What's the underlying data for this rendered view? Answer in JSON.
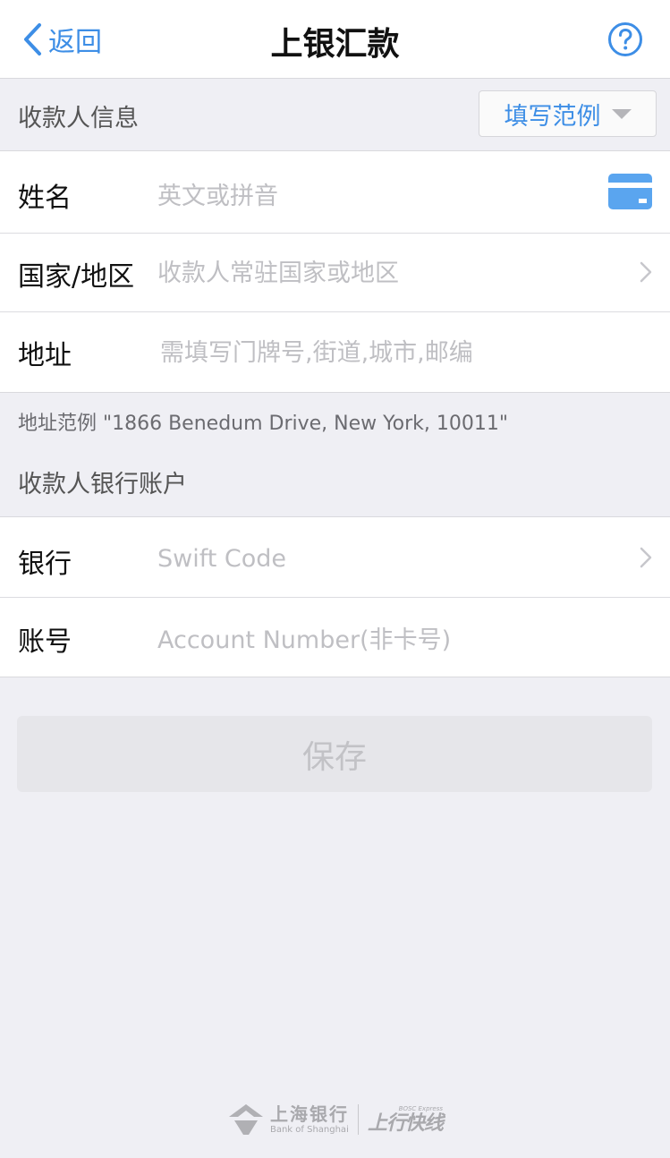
{
  "nav": {
    "back_label": "返回",
    "title": "上银汇款"
  },
  "payee_section": {
    "title": "收款人信息",
    "sample_button": "填写范例"
  },
  "payee_fields": {
    "name": {
      "label": "姓名",
      "placeholder": "英文或拼音"
    },
    "country": {
      "label": "国家/地区",
      "placeholder": "收款人常驻国家或地区"
    },
    "address": {
      "label": "地址",
      "placeholder": "需填写门牌号,街道,城市,邮编"
    }
  },
  "address_note": "地址范例 \"1866 Benedum Drive, New York, 10011\"",
  "bank_section": {
    "title": "收款人银行账户"
  },
  "bank_fields": {
    "bank": {
      "label": "银行",
      "placeholder": "Swift Code"
    },
    "account": {
      "label": "账号",
      "placeholder": "Account Number(非卡号)"
    }
  },
  "save_button": "保存",
  "footer": {
    "bank_name_cn": "上海银行",
    "bank_name_en": "Bank of Shanghai",
    "express_en": "BOSC Express",
    "express_cn": "上行快线"
  },
  "colors": {
    "accent": "#3d8ee6",
    "background": "#efeff4",
    "placeholder": "#bfbfc3",
    "disabled_button": "#e6e6ea"
  }
}
